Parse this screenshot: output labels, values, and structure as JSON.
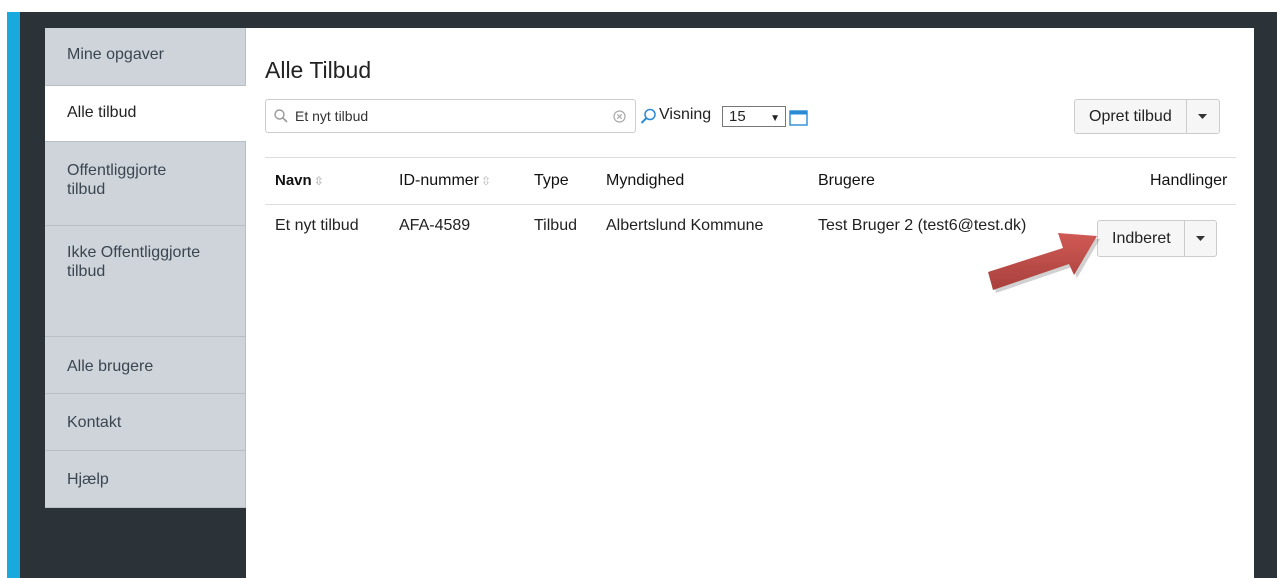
{
  "sidebar": {
    "items": [
      {
        "label": "Mine opgaver",
        "active": false
      },
      {
        "label": "Alle tilbud",
        "active": true
      },
      {
        "label": "Offentliggjorte tilbud",
        "active": false
      },
      {
        "label": "Ikke Offentliggjorte tilbud",
        "active": false
      },
      {
        "label": "Alle brugere",
        "active": false
      },
      {
        "label": "Kontakt",
        "active": false
      },
      {
        "label": "Hjælp",
        "active": false
      }
    ]
  },
  "main": {
    "title": "Alle Tilbud",
    "search": {
      "value": "Et nyt tilbud",
      "placeholder": ""
    },
    "visning": {
      "label": "Visning",
      "selected": "15"
    },
    "create_button": "Opret tilbud"
  },
  "table": {
    "headers": [
      "Navn",
      "ID-nummer",
      "Type",
      "Myndighed",
      "Brugere",
      "Handlinger"
    ],
    "rows": [
      {
        "navn": "Et nyt tilbud",
        "id": "AFA-4589",
        "type": "Tilbud",
        "myndighed": "Albertslund Kommune",
        "brugere": "Test Bruger 2 (test6@test.dk)",
        "action": "Indberet"
      }
    ]
  },
  "colors": {
    "accent": "#1aa9dd",
    "dark": "#2b3238",
    "sidebar": "#ced4da",
    "arrow": "#c0504d"
  },
  "icons": [
    "search-icon",
    "clear-icon",
    "calendar-icon",
    "chevron-down-icon",
    "sort-icon",
    "arrow-annotation"
  ]
}
